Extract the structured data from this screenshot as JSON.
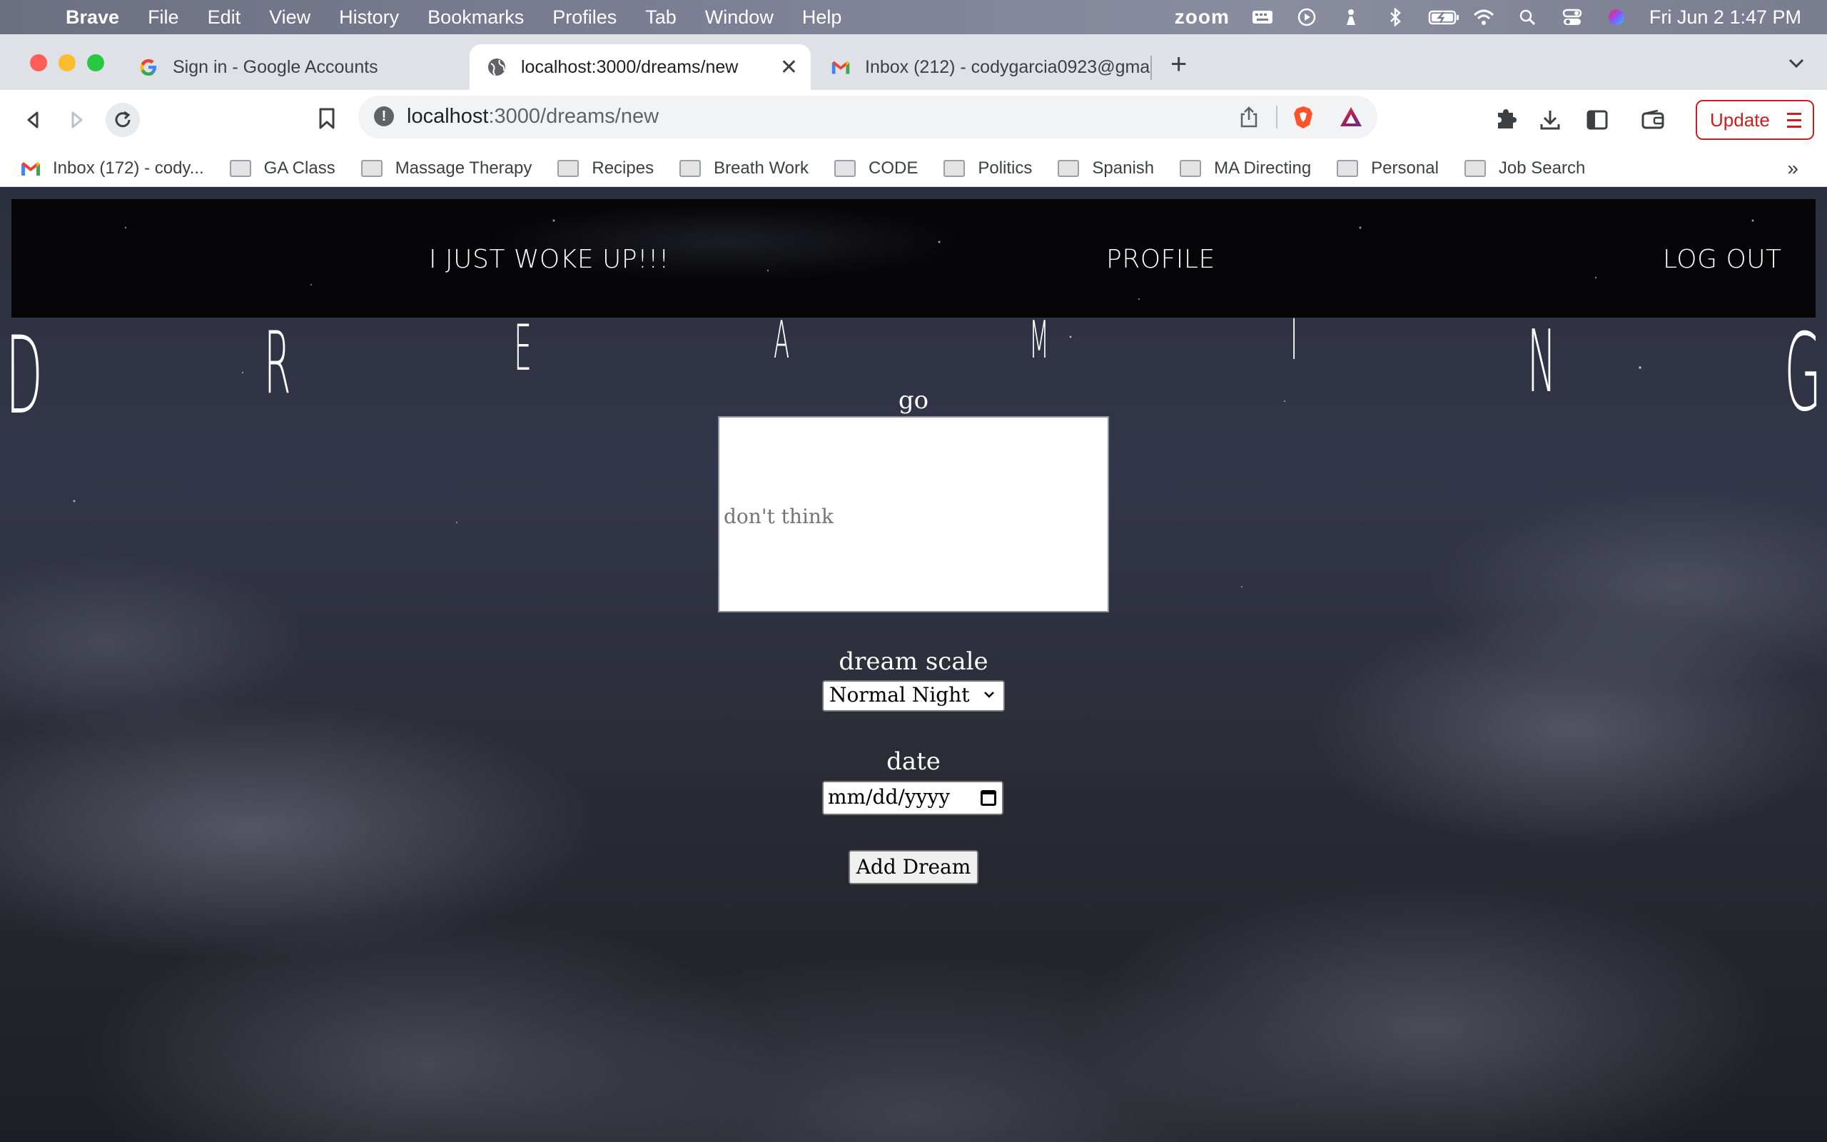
{
  "menubar": {
    "app": "Brave",
    "items": [
      "File",
      "Edit",
      "View",
      "History",
      "Bookmarks",
      "Profiles",
      "Tab",
      "Window",
      "Help"
    ],
    "zoom": "zoom",
    "datetime": "Fri Jun 2  1:47 PM"
  },
  "tabs": [
    {
      "title": "Sign in - Google Accounts",
      "icon": "google-icon"
    },
    {
      "title": "localhost:3000/dreams/new",
      "icon": "globe-icon",
      "close": "✕"
    },
    {
      "title": "Inbox (212) - codygarcia0923@gma",
      "icon": "gmail-icon"
    }
  ],
  "newtab": "+",
  "address": {
    "host": "localhost",
    "path": ":3000/dreams/new"
  },
  "update_label": "Update",
  "bookmarks": [
    {
      "label": "Inbox (172) - cody...",
      "icon": "gmail-icon"
    },
    {
      "label": "GA Class",
      "icon": "folder-icon"
    },
    {
      "label": "Massage Therapy",
      "icon": "folder-icon"
    },
    {
      "label": "Recipes",
      "icon": "folder-icon"
    },
    {
      "label": "Breath Work",
      "icon": "folder-icon"
    },
    {
      "label": "CODE",
      "icon": "folder-icon"
    },
    {
      "label": "Politics",
      "icon": "folder-icon"
    },
    {
      "label": "Spanish",
      "icon": "folder-icon"
    },
    {
      "label": "MA Directing",
      "icon": "folder-icon"
    },
    {
      "label": "Personal",
      "icon": "folder-icon"
    },
    {
      "label": "Job Search",
      "icon": "folder-icon"
    }
  ],
  "bookmarks_more": "»",
  "site": {
    "nav": {
      "woke": "I JUST WOKE UP!!!",
      "profile": "PROFILE",
      "logout": "LOG OUT"
    },
    "title_letters": [
      "D",
      "R",
      "E",
      "A",
      "M",
      "I",
      "N",
      "G"
    ],
    "form": {
      "dream_label": "go",
      "dream_placeholder": "don't think",
      "scale_label": "dream scale",
      "scale_value": "Normal Night",
      "date_label": "date",
      "date_placeholder": "mm/dd/yyyy",
      "submit": "Add Dream"
    }
  }
}
